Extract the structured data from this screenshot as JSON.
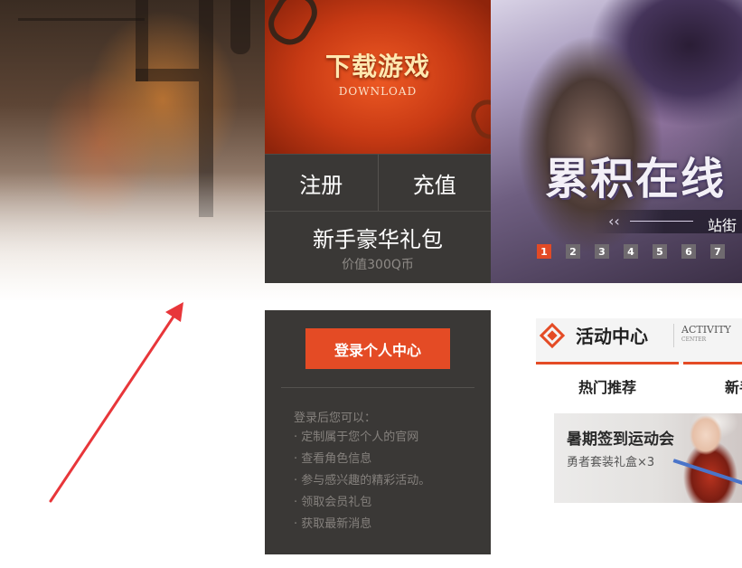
{
  "download": {
    "title": "下载游戏",
    "subtitle": "DOWNLOAD"
  },
  "actions": {
    "register_label": "注册",
    "recharge_label": "充值"
  },
  "gift": {
    "title": "新手豪华礼包",
    "value": "价值300Q币"
  },
  "carousel": {
    "slogan": "累积在线",
    "subtitle": "站街",
    "pages": [
      "1",
      "2",
      "3",
      "4",
      "5",
      "6",
      "7"
    ],
    "active_page": "1"
  },
  "login": {
    "button_label": "登录个人中心",
    "intro": "登录后您可以：",
    "benefits": [
      "· 定制属于您个人的官网",
      "· 查看角色信息",
      "· 参与感兴趣的精彩活动。",
      "· 领取会员礼包",
      "· 获取最新消息"
    ]
  },
  "activity": {
    "title": "活动中心",
    "title_en": "ACTIVITY",
    "title_en_small": "CENTER",
    "tabs": [
      {
        "label": "热门推荐"
      },
      {
        "label": "新手"
      }
    ],
    "promo": {
      "title": "暑期签到运动会",
      "subtitle": "勇者套装礼盒×3"
    }
  },
  "colors": {
    "accent": "#e44b25",
    "panel": "#3a3836",
    "muted_text": "#85817d",
    "annotation_arrow": "#e8363a"
  }
}
